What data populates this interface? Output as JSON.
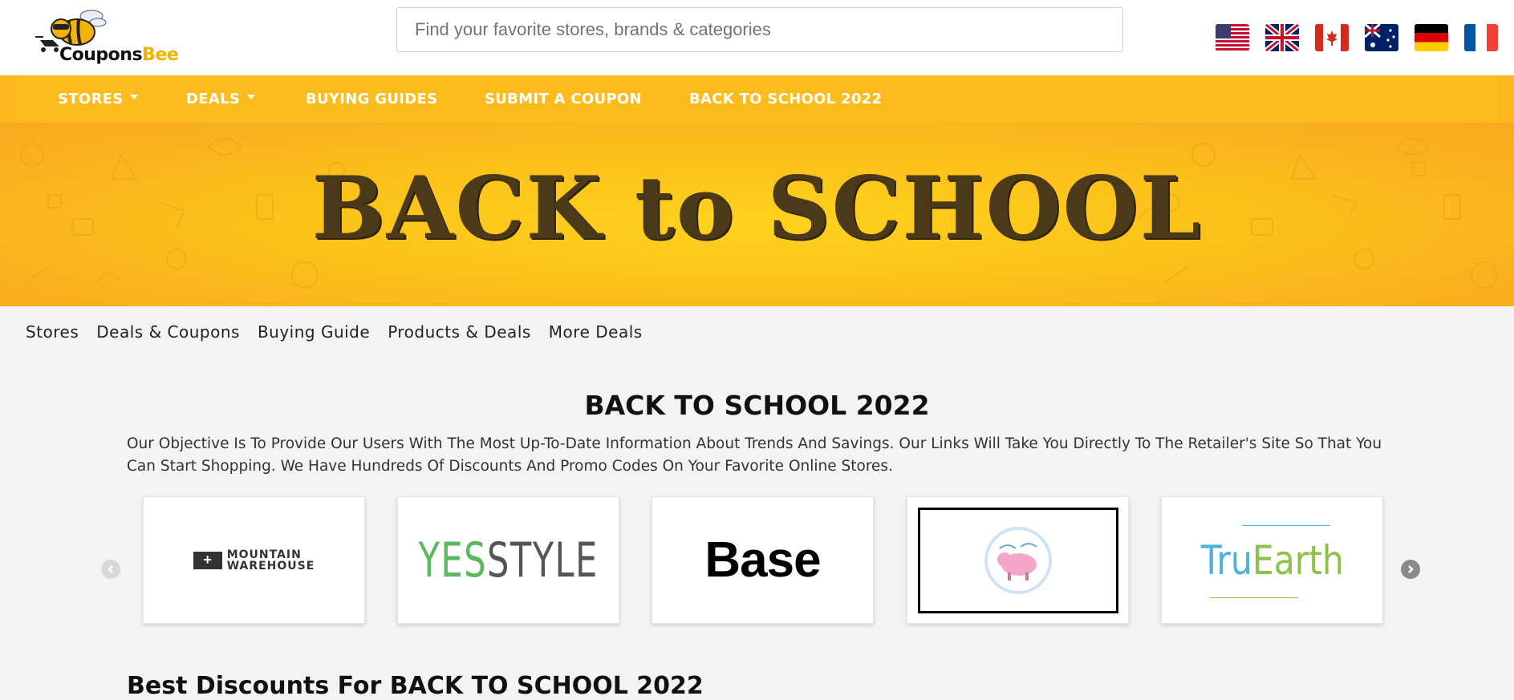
{
  "logo": {
    "part1": "Coupons",
    "part2": "Bee",
    "alt": "CouponsBee"
  },
  "search": {
    "placeholder": "Find your favorite stores, brands & categories",
    "value": ""
  },
  "flags": [
    {
      "name": "us-flag-icon",
      "label": "United States"
    },
    {
      "name": "uk-flag-icon",
      "label": "United Kingdom"
    },
    {
      "name": "canada-flag-icon",
      "label": "Canada"
    },
    {
      "name": "australia-flag-icon",
      "label": "Australia"
    },
    {
      "name": "germany-flag-icon",
      "label": "Germany"
    },
    {
      "name": "france-flag-icon",
      "label": "France"
    }
  ],
  "nav": {
    "stores": "STORES",
    "deals": "DEALS",
    "buying_guides": "BUYING GUIDES",
    "submit_coupon": "SUBMIT A COUPON",
    "back_to_school": "BACK TO SCHOOL 2022"
  },
  "banner": {
    "text": "BACK to SCHOOL"
  },
  "subnav": [
    "Stores",
    "Deals & Coupons",
    "Buying Guide",
    "Products & Deals",
    "More Deals"
  ],
  "page_title": "BACK TO SCHOOL 2022",
  "intro": "Our Objective Is To Provide Our Users With The Most Up-To-Date Information About Trends And Savings. Our Links Will Take You Directly To The Retailer's Site So That You Can Start Shopping. We Have Hundreds Of Discounts And Promo Codes On Your Favorite Online Stores.",
  "carousel": {
    "stores": [
      {
        "name": "Mountain Warehouse",
        "line1": "MOUNTAIN",
        "line2": "WAREHOUSE"
      },
      {
        "name": "YesStyle",
        "part1": "YES",
        "part2": "STYLE"
      },
      {
        "name": "Base",
        "text": "Base"
      },
      {
        "name": "Pink Pig",
        "text": ""
      },
      {
        "name": "TruEarth",
        "part1": "Tru",
        "part2": "Earth"
      }
    ]
  },
  "partial_heading": "Best Discounts For BACK TO SCHOOL 2022",
  "colors": {
    "accent": "#fdbc1d",
    "banner": "#fcc11a",
    "nav_text": "#ffffff"
  }
}
